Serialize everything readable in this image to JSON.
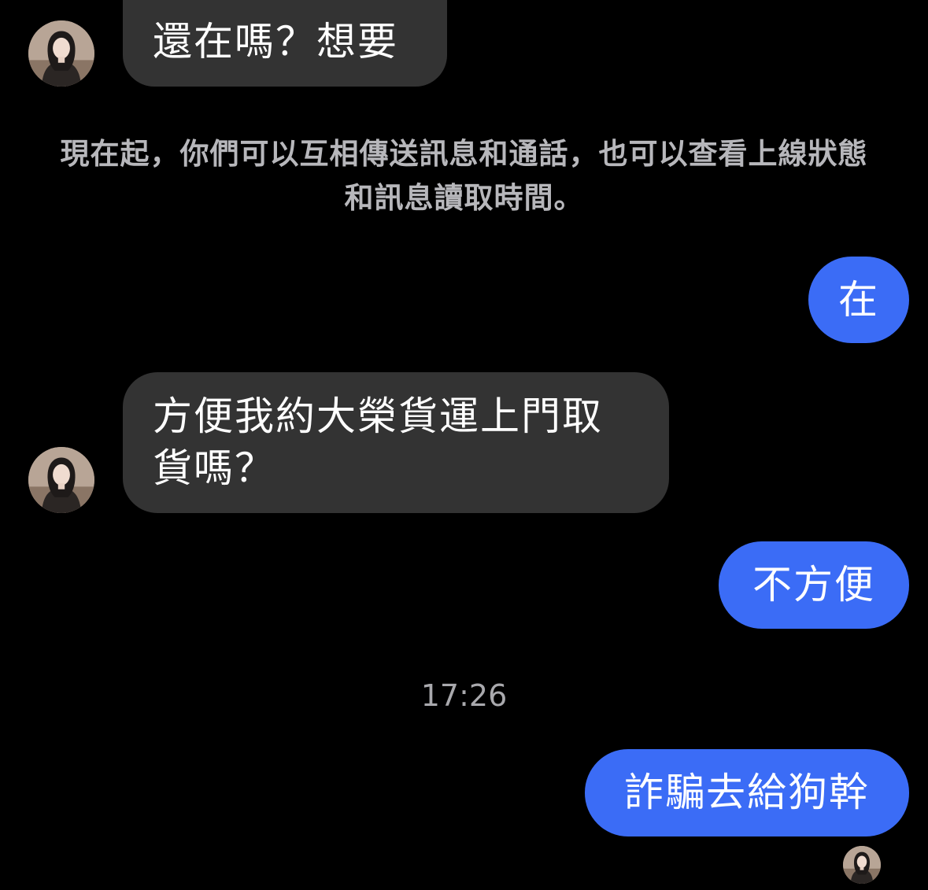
{
  "conversation": {
    "messages": [
      {
        "direction": "incoming",
        "text": "還在嗎？想要"
      },
      {
        "direction": "incoming",
        "text": "方便我約大榮貨運上門取貨嗎？"
      },
      {
        "direction": "outgoing",
        "text": "在"
      },
      {
        "direction": "outgoing",
        "text": "不方便"
      },
      {
        "direction": "outgoing",
        "text": "詐騙去給狗幹"
      }
    ],
    "system_notice": "現在起，你們可以互相傳送訊息和通話，也可以查看上線狀態和訊息讀取時間。",
    "timestamp": "17:26"
  },
  "colors": {
    "background": "#000000",
    "incoming_bubble": "#333333",
    "outgoing_bubble": "#3b6cf6",
    "system_text": "#b7b7bb",
    "timestamp_text": "#a9a9ad"
  }
}
